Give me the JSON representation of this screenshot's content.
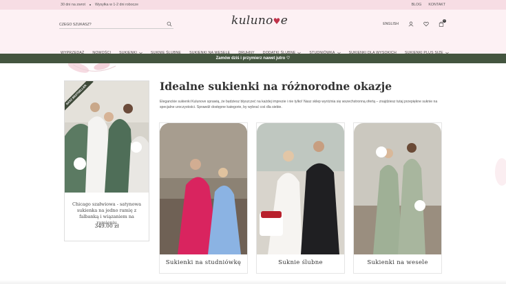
{
  "topbar": {
    "returns": "30 dni na zwrot",
    "shipping": "Wysyłka w 1-2 dni robocze",
    "blog": "BLOG",
    "contact": "KONTAKT"
  },
  "header": {
    "search_placeholder": "CZEGO SZUKASZ?",
    "logo": "kuluno",
    "logo_heart": "♥",
    "logo_tail": "e",
    "language": "ENGLISH",
    "cart_count": "0"
  },
  "nav": [
    {
      "label": "WYPRZEDAŻ",
      "dropdown": false
    },
    {
      "label": "NOWOŚCI",
      "dropdown": false
    },
    {
      "label": "SUKIENKI",
      "dropdown": true
    },
    {
      "label": "SUKNIE ŚLUBNE",
      "dropdown": false
    },
    {
      "label": "SUKIENKI NA WESELE",
      "dropdown": false
    },
    {
      "label": "DRUHNY",
      "dropdown": false
    },
    {
      "label": "DODATKI ŚLUBNE",
      "dropdown": true
    },
    {
      "label": "STUDNIÓWKA",
      "dropdown": true
    },
    {
      "label": "SUKIENKI DLA WYSOKICH",
      "dropdown": false
    },
    {
      "label": "SUKIENKI PLUS SIZE",
      "dropdown": true
    }
  ],
  "promo": "Zamów dziś i przymierz nawet jutro ♡",
  "product": {
    "badge": "NASZ BESTSELLER",
    "name": "Chicago szałwiowa - satynowa sukienka na jedno ramię z falbanką i wiązaniem na ramieniu",
    "price": "349.00 zł"
  },
  "main": {
    "heading": "Idealne sukienki na różnorodne okazje",
    "description": "Eleganckie sukienki Kulunove sprawią, że będziesz błyszczeć na każdej imprezie i nie tylko! Nasz sklep wyróżnia się wszechstronną ofertą – znajdziesz tutaj przepiękne suknie na specjalne uroczystości. Sprawdź dostępne kategorie, by wybrać coś dla siebie."
  },
  "categories": [
    {
      "label": "Sukienki na studniówkę"
    },
    {
      "label": "Suknie ślubne"
    },
    {
      "label": "Sukienki na wesele"
    }
  ],
  "colors": {
    "topbar": "#f7dde4",
    "header": "#fdf1f4",
    "promo": "#44553f",
    "accent": "#c0334a"
  }
}
